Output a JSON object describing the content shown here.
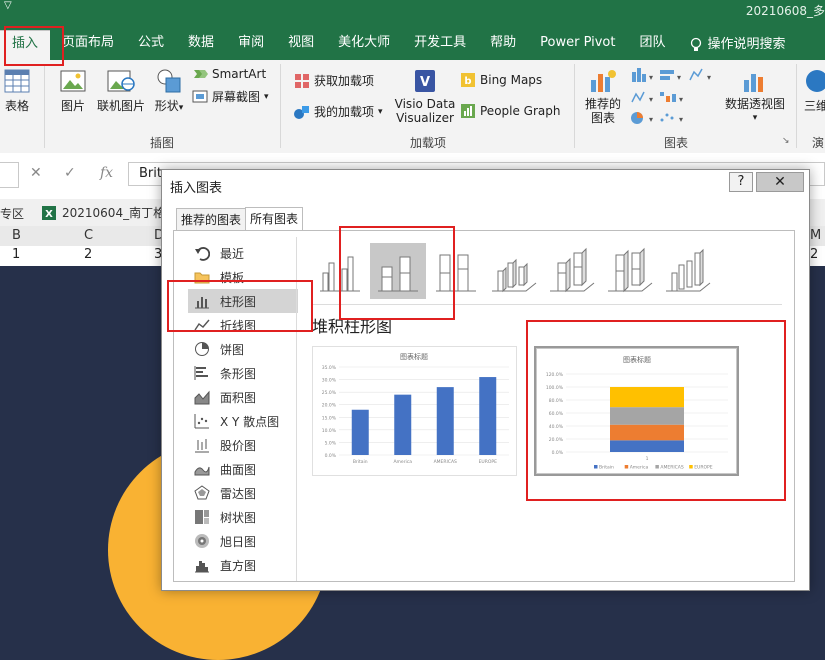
{
  "window": {
    "title": "20210608_多"
  },
  "ribbon_tabs": [
    {
      "label": "插入",
      "active": true
    },
    {
      "label": "页面布局"
    },
    {
      "label": "公式"
    },
    {
      "label": "数据"
    },
    {
      "label": "审阅"
    },
    {
      "label": "视图"
    },
    {
      "label": "美化大师"
    },
    {
      "label": "开发工具"
    },
    {
      "label": "帮助"
    },
    {
      "label": "Power Pivot"
    },
    {
      "label": "团队"
    },
    {
      "label": "操作说明搜索"
    }
  ],
  "ribbon": {
    "table": "表格",
    "picture": "图片",
    "online_picture": "联机图片",
    "shapes": "形状",
    "smartart": "SmartArt",
    "screenshot": "屏幕截图",
    "illustrations_group": "插图",
    "get_addins": "获取加载项",
    "my_addins": "我的加载项",
    "visio": "Visio Data Visualizer",
    "bing_maps": "Bing Maps",
    "people_graph": "People Graph",
    "addins_group": "加载项",
    "recommended_charts": "推荐的图表",
    "pivotchart": "数据透视图",
    "charts_group": "图表",
    "three_d": "三维",
    "tour": "演"
  },
  "formula_bar": {
    "value": "Brit"
  },
  "workbook": {
    "left_label": "专区",
    "file_name": "20210604_南丁格"
  },
  "sheet": {
    "columns": [
      "B",
      "C",
      "D",
      "M"
    ],
    "row1": [
      "1",
      "2",
      "3",
      "2"
    ]
  },
  "dialog": {
    "title": "插入图表",
    "help": "?",
    "close": "✕",
    "tabs": [
      "推荐的图表",
      "所有图表"
    ],
    "categories": [
      {
        "label": "最近",
        "icon": "undo-icon"
      },
      {
        "label": "模板",
        "icon": "folder-icon"
      },
      {
        "label": "柱形图",
        "icon": "column-chart-icon",
        "selected": true
      },
      {
        "label": "折线图",
        "icon": "line-chart-icon"
      },
      {
        "label": "饼图",
        "icon": "pie-chart-icon"
      },
      {
        "label": "条形图",
        "icon": "bar-chart-icon"
      },
      {
        "label": "面积图",
        "icon": "area-chart-icon"
      },
      {
        "label": "X Y 散点图",
        "icon": "scatter-chart-icon"
      },
      {
        "label": "股价图",
        "icon": "stock-chart-icon"
      },
      {
        "label": "曲面图",
        "icon": "surface-chart-icon"
      },
      {
        "label": "雷达图",
        "icon": "radar-chart-icon"
      },
      {
        "label": "树状图",
        "icon": "treemap-icon"
      },
      {
        "label": "旭日图",
        "icon": "sunburst-icon"
      },
      {
        "label": "直方图",
        "icon": "histogram-icon"
      }
    ],
    "subtype_name": "堆积柱形图",
    "subtypes": [
      "clustered-column-icon",
      "stacked-column-icon",
      "100-stacked-column-icon",
      "3d-clustered-column-icon",
      "3d-stacked-column-icon",
      "3d-100-stacked-column-icon",
      "3d-column-icon"
    ]
  },
  "chart_data": [
    {
      "type": "bar",
      "title": "图表标题",
      "categories": [
        "Britain",
        "America",
        "AMERICAS",
        "EUROPE"
      ],
      "values": [
        18,
        24,
        27,
        31
      ],
      "ylim": [
        0,
        35
      ],
      "yticks": [
        "0.0%",
        "5.0%",
        "10.0%",
        "15.0%",
        "20.0%",
        "25.0%",
        "30.0%",
        "35.0%"
      ],
      "color": "#4472c4",
      "grid": true
    },
    {
      "type": "bar",
      "stacked": "percent",
      "title": "图表标题",
      "categories": [
        "1"
      ],
      "series": [
        {
          "name": "Britain",
          "values": [
            18
          ],
          "color": "#4472c4"
        },
        {
          "name": "America",
          "values": [
            24
          ],
          "color": "#ed7d31"
        },
        {
          "name": "AMERICAS",
          "values": [
            27
          ],
          "color": "#a5a5a5"
        },
        {
          "name": "EUROPE",
          "values": [
            31
          ],
          "color": "#ffc000"
        }
      ],
      "ylim": [
        0,
        120
      ],
      "yticks": [
        "0.0%",
        "20.0%",
        "40.0%",
        "60.0%",
        "80.0%",
        "100.0%",
        "120.0%"
      ],
      "legend": "bottom",
      "grid": true
    }
  ]
}
